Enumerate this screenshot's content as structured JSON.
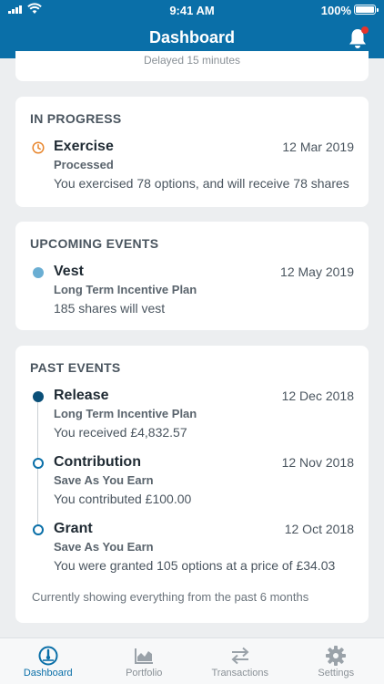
{
  "status_bar": {
    "time": "9:41 AM",
    "battery": "100%"
  },
  "header": {
    "title": "Dashboard"
  },
  "top_card": {
    "faded_text": "Delayed 15 minutes"
  },
  "in_progress": {
    "title": "IN PROGRESS",
    "events": [
      {
        "name": "Exercise",
        "date": "12 Mar 2019",
        "sub": "Processed",
        "desc": "You exercised 78 options, and will receive 78 shares",
        "marker": "clock-icon"
      }
    ]
  },
  "upcoming": {
    "title": "UPCOMING EVENTS",
    "events": [
      {
        "name": "Vest",
        "date": "12 May 2019",
        "sub": "Long Term Incentive Plan",
        "desc": "185 shares will vest",
        "marker": "light"
      }
    ]
  },
  "past": {
    "title": "PAST EVENTS",
    "events": [
      {
        "name": "Release",
        "date": "12 Dec 2018",
        "sub": "Long Term Incentive Plan",
        "desc": "You received £4,832.57",
        "marker": "filled"
      },
      {
        "name": "Contribution",
        "date": "12 Nov 2018",
        "sub": "Save As You Earn",
        "desc": "You contributed £100.00",
        "marker": "hollow"
      },
      {
        "name": "Grant",
        "date": "12 Oct 2018",
        "sub": "Save As You Earn",
        "desc": "You were granted 105 options at a price of £34.03",
        "marker": "hollow"
      }
    ],
    "footnote": "Currently showing everything from the past 6 months"
  },
  "tabs": [
    {
      "label": "Dashboard",
      "icon": "gauge-icon",
      "active": true
    },
    {
      "label": "Portfolio",
      "icon": "chart-icon",
      "active": false
    },
    {
      "label": "Transactions",
      "icon": "transfer-arrows-icon",
      "active": false
    },
    {
      "label": "Settings",
      "icon": "gear-icon",
      "active": false
    }
  ],
  "colors": {
    "brand": "#0a6fa8",
    "accent_orange": "#e8852b",
    "notification": "#e8342b"
  }
}
